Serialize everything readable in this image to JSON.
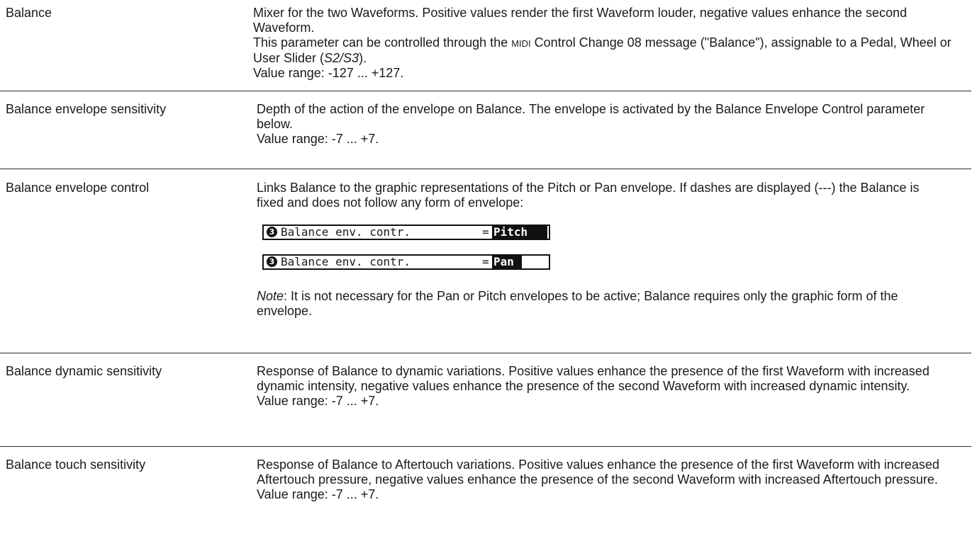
{
  "entries": [
    {
      "term": "Balance",
      "desc_lines": [
        "Mixer for the two Waveforms. Positive values render the first Waveform louder, negative values enhance the second Waveform."
      ],
      "cc_before": "This parameter can be controlled through the ",
      "cc_midi": "MIDI",
      "cc_after": " Control Change 08 message (\"Balance\"), assignable to a Pedal, Wheel or User Slider (",
      "cc_slider": "S2/S3",
      "cc_end": ").",
      "range": "Value range: -127 ... +127."
    },
    {
      "term": "Balance envelope sensitivity",
      "desc": "Depth of the action of the envelope on Balance. The envelope is activated by the Balance Envelope Control parameter below.",
      "range": "Value range: -7 ... +7."
    },
    {
      "term": "Balance envelope control",
      "desc": "Links Balance to the graphic representations of the Pitch or Pan envelope. If dashes are displayed (---) the Balance is fixed and does not follow any form of envelope:",
      "displays": [
        {
          "number": "3",
          "label": "Balance env. contr.",
          "eq": "=",
          "value": "Pitch"
        },
        {
          "number": "3",
          "label": "Balance env. contr.",
          "eq": "=",
          "value": "Pan"
        }
      ],
      "note_label": "Note",
      "note_text": ":  It is not necessary for the Pan or Pitch envelopes to be active; Balance requires only the graphic form of the envelope."
    },
    {
      "term": "Balance dynamic sensitivity",
      "desc": "Response of Balance to dynamic variations. Positive values enhance the presence of the first Waveform with increased dynamic intensity, negative values enhance the presence of the second Waveform with increased dynamic intensity.",
      "range": "Value range: -7 ... +7."
    },
    {
      "term": "Balance touch sensitivity",
      "desc": "Response of Balance to Aftertouch variations. Positive values enhance the presence of the first Waveform with increased Aftertouch pressure, negative values enhance the presence of the second Waveform with increased Aftertouch pressure.",
      "range": "Value range: -7 ... +7."
    }
  ]
}
